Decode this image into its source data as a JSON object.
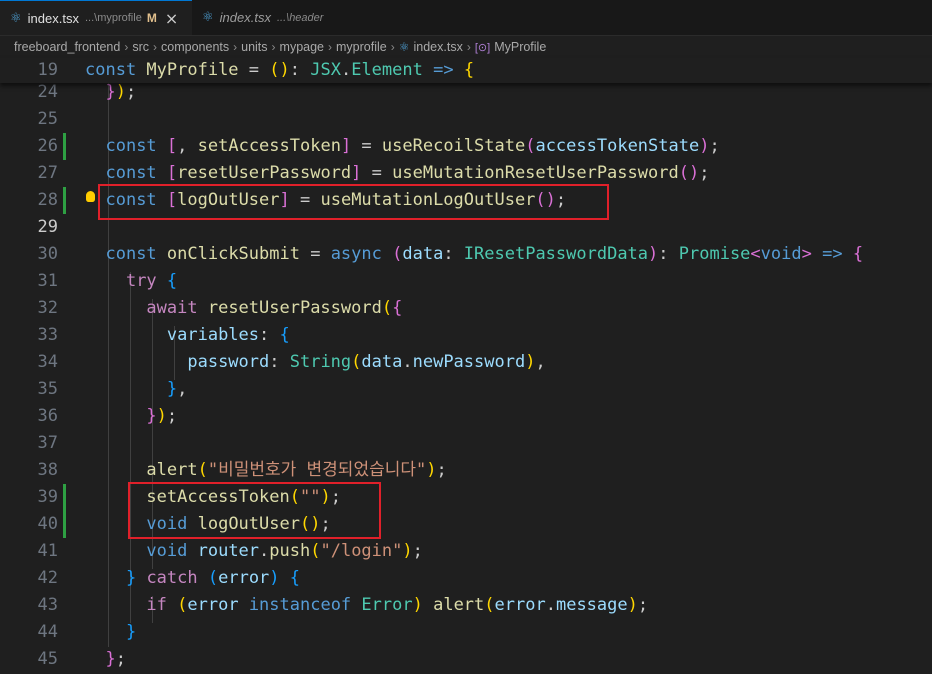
{
  "tabs": [
    {
      "icon": "react-icon",
      "name": "index.tsx",
      "path": "...\\myprofile",
      "modified": "M",
      "close": "×"
    },
    {
      "icon": "react-icon",
      "name": "index.tsx",
      "path": "...\\header"
    }
  ],
  "breadcrumb": [
    "freeboard_frontend",
    "src",
    "components",
    "units",
    "mypage",
    "myprofile",
    "index.tsx",
    "MyProfile"
  ],
  "breadcrumb_symbol": "[⊙]",
  "line_numbers": {
    "sticky": "19",
    "l24": "24",
    "l25": "25",
    "l26": "26",
    "l27": "27",
    "l28": "28",
    "l29": "29",
    "l30": "30",
    "l31": "31",
    "l32": "32",
    "l33": "33",
    "l34": "34",
    "l35": "35",
    "l36": "36",
    "l37": "37",
    "l38": "38",
    "l39": "39",
    "l40": "40",
    "l41": "41",
    "l42": "42",
    "l43": "43",
    "l44": "44",
    "l45": "45"
  },
  "code": {
    "sticky": {
      "const": "const ",
      "name": "MyProfile",
      "eq": " = ",
      "paren": "()",
      "colon": ": ",
      "jsx": "JSX",
      "dot": ".",
      "element": "Element",
      "arrow": " => ",
      "brace": "{"
    },
    "l24": {
      "brace": "}",
      "paren": ")",
      "semi": ";"
    },
    "l26": {
      "const": "const ",
      "lb": "[",
      "comma": ", ",
      "setter": "setAccessToken",
      "rb": "]",
      "eq": " = ",
      "fn": "useRecoilState",
      "lp": "(",
      "arg": "accessTokenState",
      "rp": ")",
      "semi": ";"
    },
    "l27": {
      "const": "const ",
      "lb": "[",
      "name": "resetUserPassword",
      "rb": "]",
      "eq": " = ",
      "fn": "useMutationResetUserPassword",
      "parens": "()",
      "semi": ";"
    },
    "l28": {
      "const": "const ",
      "lb": "[",
      "name": "logOutUser",
      "rb": "]",
      "eq": " = ",
      "fn": "useMutationLogOutUser",
      "parens": "()",
      "semi": ";"
    },
    "l30": {
      "const": "const ",
      "name": "onClickSubmit",
      "eq": " = ",
      "async": "async ",
      "lp": "(",
      "param": "data",
      "colon": ": ",
      "type": "IResetPasswordData",
      "rp": ")",
      "colon2": ": ",
      "promise": "Promise",
      "lt": "<",
      "void": "void",
      "gt": ">",
      "arrow": " => ",
      "brace": "{"
    },
    "l31": {
      "try": "try ",
      "brace": "{"
    },
    "l32": {
      "await": "await ",
      "fn": "resetUserPassword",
      "lp": "(",
      "brace": "{"
    },
    "l33": {
      "key": "variables",
      "colon": ": ",
      "brace": "{"
    },
    "l34": {
      "key": "password",
      "colon": ": ",
      "fn": "String",
      "lp": "(",
      "obj": "data",
      "dot": ".",
      "prop": "newPassword",
      "rp": ")",
      "comma": ","
    },
    "l35": {
      "brace": "}",
      "comma": ","
    },
    "l36": {
      "brace": "}",
      "rp": ")",
      "semi": ";"
    },
    "l38": {
      "fn": "alert",
      "lp": "(",
      "str": "\"비밀번호가 변경되었습니다\"",
      "rp": ")",
      "semi": ";"
    },
    "l39": {
      "fn": "setAccessToken",
      "lp": "(",
      "str": "\"\"",
      "rp": ")",
      "semi": ";"
    },
    "l40": {
      "void": "void ",
      "fn": "logOutUser",
      "parens": "()",
      "semi": ";"
    },
    "l41": {
      "void": "void ",
      "obj": "router",
      "dot": ".",
      "fn": "push",
      "lp": "(",
      "str": "\"/login\"",
      "rp": ")",
      "semi": ";"
    },
    "l42": {
      "brace": "} ",
      "catch": "catch ",
      "lp": "(",
      "err": "error",
      "rp": ")",
      "brace2": " {"
    },
    "l43": {
      "if": "if ",
      "lp": "(",
      "err": "error",
      "inst": " instanceof ",
      "type": "Error",
      "rp": ")",
      "sp": " ",
      "fn": "alert",
      "lp2": "(",
      "obj": "error",
      "dot": ".",
      "prop": "message",
      "rp2": ")",
      "semi": ";"
    },
    "l44": {
      "brace": "}"
    },
    "l45": {
      "brace": "}",
      "semi": ";"
    }
  },
  "colors": {
    "keyword": "#569cd6",
    "control": "#c586c0",
    "function": "#dcdcaa",
    "variable": "#9cdcfe",
    "type": "#4ec9b0",
    "string": "#ce9178",
    "highlight_box": "#e0202a"
  }
}
